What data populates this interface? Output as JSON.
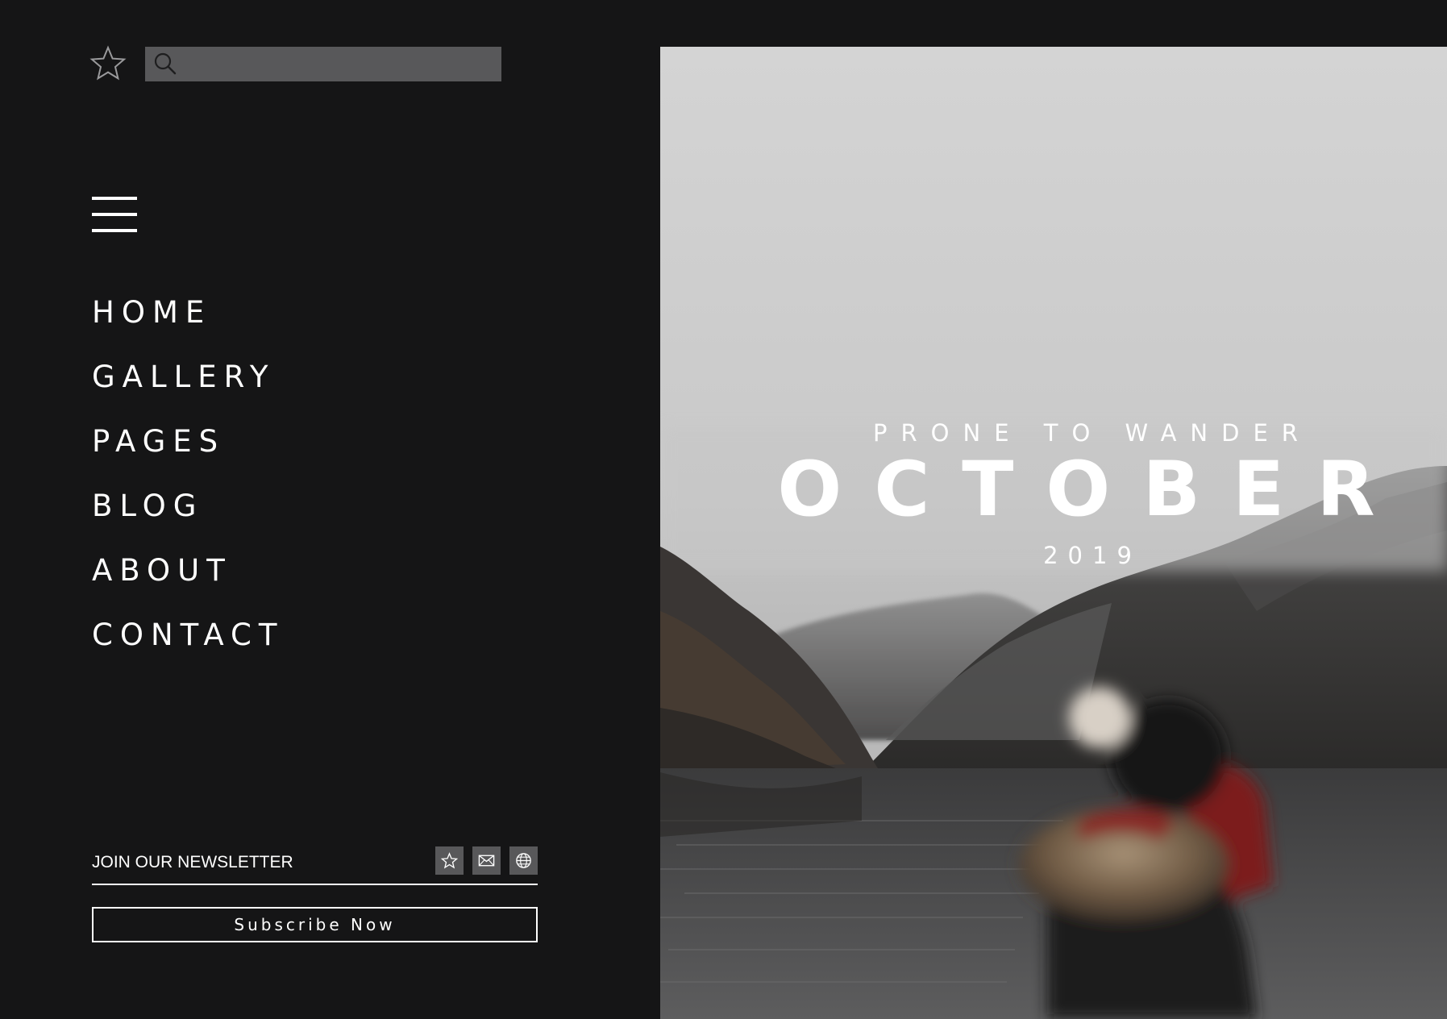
{
  "search": {
    "value": "",
    "placeholder": ""
  },
  "nav": {
    "items": [
      "HOME",
      "GALLERY",
      "PAGES",
      "BLOG",
      "ABOUT",
      "CONTACT"
    ]
  },
  "newsletter": {
    "label": "JOIN OUR NEWSLETTER",
    "icons": [
      "star-icon",
      "mail-icon",
      "globe-icon"
    ],
    "subscribe_label": "Subscribe Now"
  },
  "hero": {
    "subtitle": "PRONE TO WANDER",
    "title": "OCTOBER",
    "year": "2019"
  },
  "colors": {
    "background": "#151516",
    "search_fill": "#58585a",
    "text": "#ffffff"
  }
}
